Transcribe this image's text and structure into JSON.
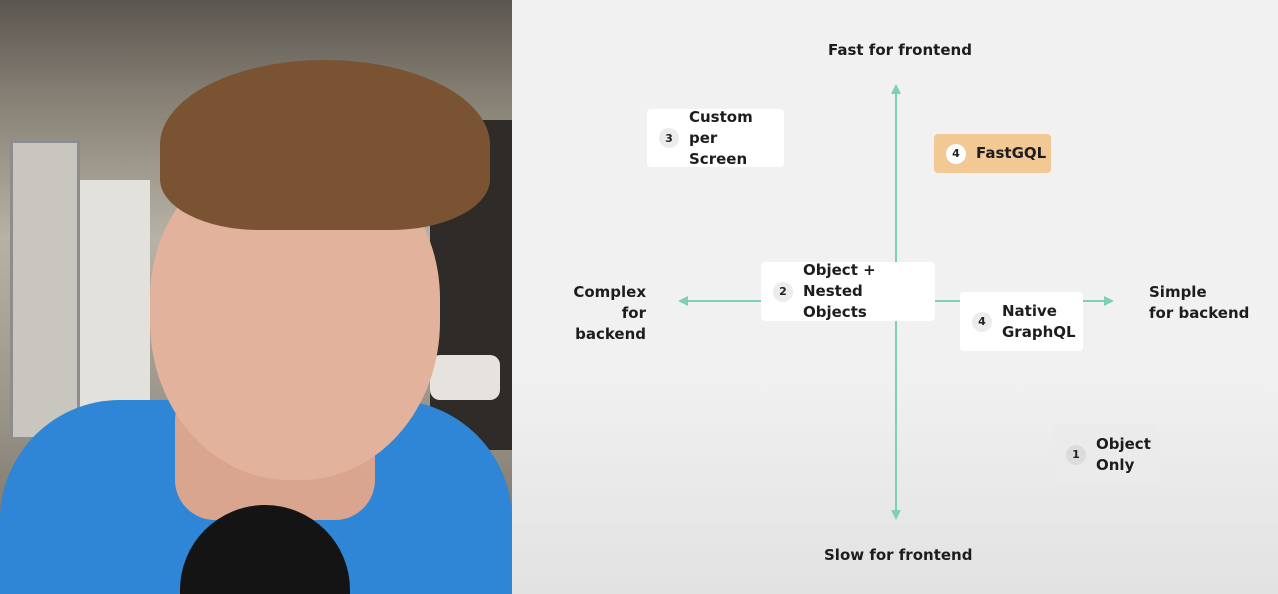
{
  "axes": {
    "top": "Fast for frontend",
    "bottom": "Slow for frontend",
    "left": "Complex\nfor backend",
    "right": "Simple\nfor backend",
    "color": "#7fcfb3"
  },
  "cards": [
    {
      "num": "3",
      "text": "Custom\nper Screen"
    },
    {
      "num": "4",
      "text": "FastGQL",
      "highlight": "#f2c994"
    },
    {
      "num": "2",
      "text": "Object +\nNested Objects"
    },
    {
      "num": "4",
      "text": "Native\nGraphQL"
    },
    {
      "num": "1",
      "text": "Object\nOnly"
    }
  ]
}
